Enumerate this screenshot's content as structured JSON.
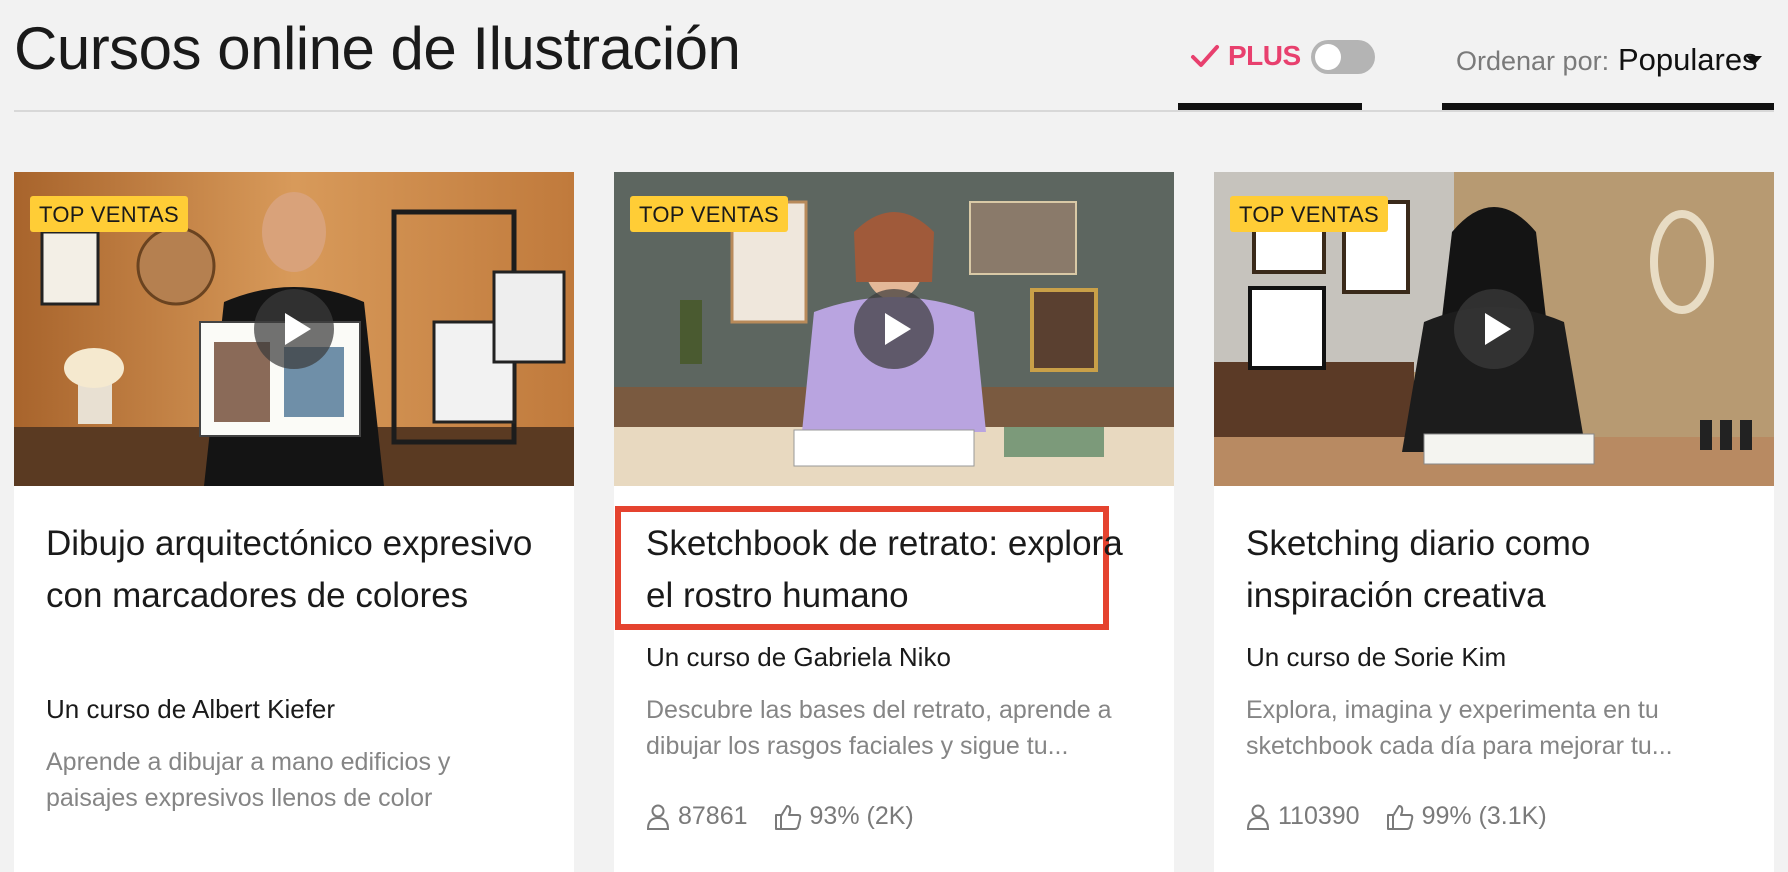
{
  "header": {
    "title": "Cursos online de Ilustración",
    "plus_label": "PLUS",
    "plus_toggle_on": false,
    "sort_label": "Ordenar por:",
    "sort_value": "Populares"
  },
  "colors": {
    "accent_plus": "#e8406e",
    "badge": "#ffcd36",
    "highlight": "#e5432f"
  },
  "cards": [
    {
      "badge": "TOP VENTAS",
      "title": "Dibujo arquitectónico expresivo con marcadores de colores",
      "author": "Un curso de Albert Kiefer",
      "description": "Aprende a dibujar a mano edificios y paisajes expresivos llenos de color"
    },
    {
      "badge": "TOP VENTAS",
      "title": "Sketchbook de retrato: explora el rostro humano",
      "author": "Un curso de Gabriela Niko",
      "description": "Descubre las bases del retrato, aprende a dibujar los rasgos faciales y sigue tu...",
      "students": "87861",
      "rating": "93% (2K)"
    },
    {
      "badge": "TOP VENTAS",
      "title": "Sketching diario como inspiración creativa",
      "author": "Un curso de Sorie Kim",
      "description": "Explora, imagina y experimenta en tu sketchbook cada día para mejorar tu...",
      "students": "110390",
      "rating": "99% (3.1K)"
    }
  ]
}
